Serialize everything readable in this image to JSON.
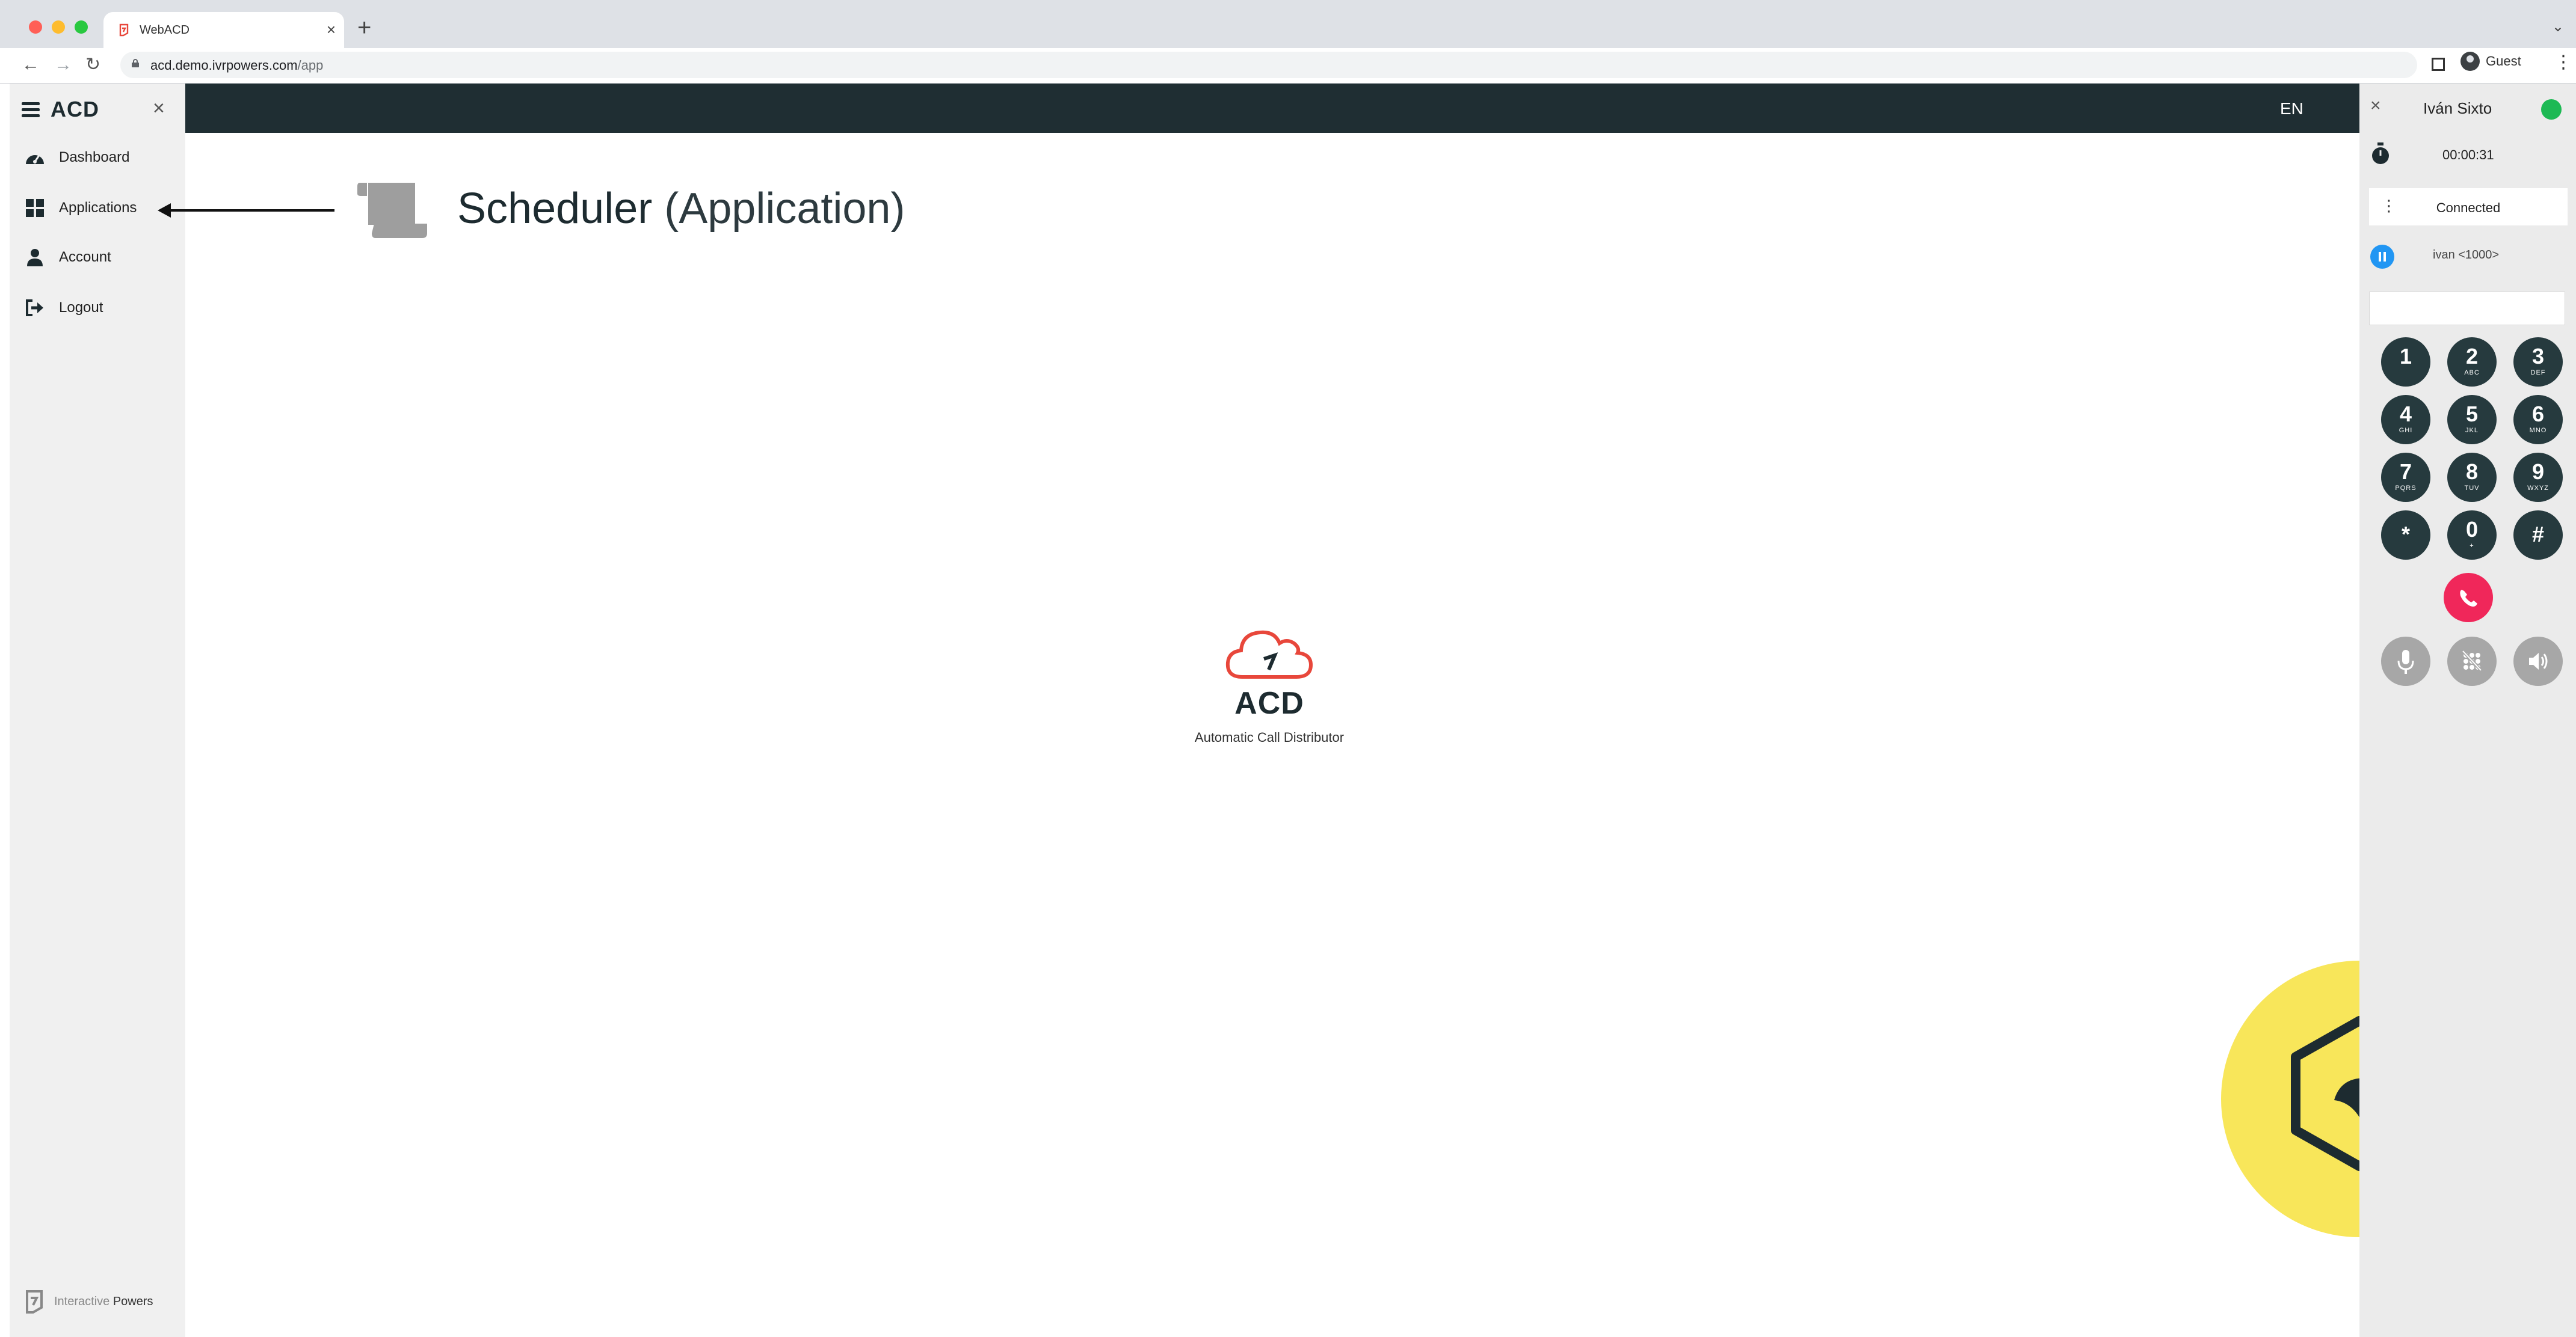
{
  "browser": {
    "tab_title": "WebACD",
    "new_tab": "+",
    "tab_close": "×",
    "url_host": "acd.demo.ivrpowers.com",
    "url_path": "/app",
    "profile_label": "Guest"
  },
  "sidebar": {
    "brand": "ACD",
    "close": "×",
    "items": [
      {
        "label": "Dashboard",
        "icon": "gauge-icon"
      },
      {
        "label": "Applications",
        "icon": "grid-icon"
      },
      {
        "label": "Account",
        "icon": "user-icon"
      },
      {
        "label": "Logout",
        "icon": "sign-out-icon"
      }
    ],
    "footer_text": "Interactive",
    "footer_bold": "Powers"
  },
  "header": {
    "language": "EN"
  },
  "main": {
    "title": "Scheduler",
    "title_suffix": "(Application)",
    "logo_text": "ACD",
    "tagline": "Automatic Call Distributor"
  },
  "phone": {
    "close": "×",
    "user": "Iván Sixto",
    "timer": "00:00:31",
    "status": "Connected",
    "call": "ivan <1000>",
    "keys": [
      {
        "d": "1",
        "l": ""
      },
      {
        "d": "2",
        "l": "ABC"
      },
      {
        "d": "3",
        "l": "DEF"
      },
      {
        "d": "4",
        "l": "GHI"
      },
      {
        "d": "5",
        "l": "JKL"
      },
      {
        "d": "6",
        "l": "MNO"
      },
      {
        "d": "7",
        "l": "PQRS"
      },
      {
        "d": "8",
        "l": "TUV"
      },
      {
        "d": "9",
        "l": "WXYZ"
      },
      {
        "d": "*",
        "l": ""
      },
      {
        "d": "0",
        "l": "+"
      },
      {
        "d": "#",
        "l": ""
      }
    ]
  },
  "colors": {
    "header_bg": "#1f2e33",
    "status_online": "#1db954",
    "hangup": "#f0275a",
    "hold": "#2196f3",
    "badge": "#f8e65a",
    "brand_red": "#e8473b"
  }
}
